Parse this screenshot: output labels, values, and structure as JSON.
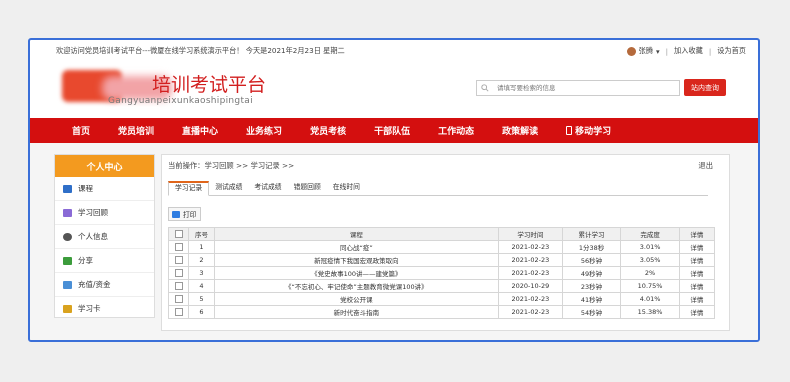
{
  "topbar": {
    "welcome": "欢迎访问党员培训考试平台---微厦在线学习系统演示平台！ 今天是2021年2月23日 星期二",
    "user_name": "张腾",
    "user_caret": "▾",
    "favorites": "加入收藏",
    "homepage": "设为首页",
    "sep": "|"
  },
  "header": {
    "logo_title": "培训考试平台",
    "logo_sub": "Gangyuanpeixunkaoshipingtai",
    "search_placeholder": "请填写要检索的信息",
    "search_button": "站内查询"
  },
  "nav": {
    "items": [
      "首页",
      "党员培训",
      "直播中心",
      "业务练习",
      "党员考核",
      "干部队伍",
      "工作动态",
      "政策解读",
      "移动学习"
    ]
  },
  "sidebar": {
    "title": "个人中心",
    "items": [
      {
        "label": "课程",
        "icon": "monitor-icon",
        "color": "#2f6fc8"
      },
      {
        "label": "学习回顾",
        "icon": "bar-chart-icon",
        "color": "#8a6ad6"
      },
      {
        "label": "个人信息",
        "icon": "person-icon",
        "color": "#555555"
      },
      {
        "label": "分享",
        "icon": "share-icon",
        "color": "#3c9c3c"
      },
      {
        "label": "充值/资金",
        "icon": "wallet-icon",
        "color": "#4a8fd6"
      },
      {
        "label": "学习卡",
        "icon": "card-icon",
        "color": "#d9a21e"
      }
    ]
  },
  "main": {
    "breadcrumb": "当前操作：学习回顾 >> 学习记录 >>",
    "logout": "退出",
    "tabs": [
      "学习记录",
      "测试成绩",
      "考试成绩",
      "错题回顾",
      "在线时间"
    ],
    "print": "打印",
    "table": {
      "headers": [
        "序号",
        "课程",
        "学习时间",
        "累计学习",
        "完成度",
        "详情"
      ],
      "rows": [
        [
          "1",
          "同心战“疫”",
          "2021-02-23",
          "1分38秒",
          "3.01%",
          "详情"
        ],
        [
          "2",
          "新冠疫情下我国宏观政策取向",
          "2021-02-23",
          "56秒钟",
          "3.05%",
          "详情"
        ],
        [
          "3",
          "《党史故事100讲——建党篇》",
          "2021-02-23",
          "49秒钟",
          "2%",
          "详情"
        ],
        [
          "4",
          "《“不忘初心、牢记使命”主题教育微党课100讲》",
          "2020-10-29",
          "23秒钟",
          "10.75%",
          "详情"
        ],
        [
          "5",
          "党校公开课",
          "2021-02-23",
          "41秒钟",
          "4.01%",
          "详情"
        ],
        [
          "6",
          "新时代奋斗指南",
          "2021-02-23",
          "54秒钟",
          "15.38%",
          "详情"
        ]
      ]
    }
  },
  "colors": {
    "nav_bg": "#d40f0f",
    "sidebar_head": "#f39a1f",
    "frame_border": "#3a6fd8",
    "tab_accent": "#e0651a"
  }
}
